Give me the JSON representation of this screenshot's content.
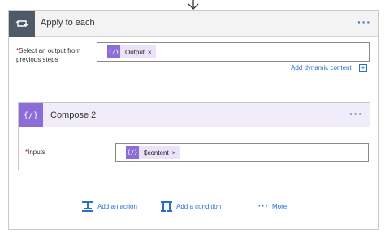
{
  "loop": {
    "title": "Apply to each",
    "more": "···",
    "select_label": "Select an output from previous steps",
    "required_mark": "*",
    "token": {
      "icon": "{/}",
      "label": "Output",
      "close": "×"
    },
    "dynamic_link": "Add dynamic content",
    "dynamic_icon": "+"
  },
  "compose": {
    "title": "Compose 2",
    "icon": "{/}",
    "more": "···",
    "inputs_label": "Inputs",
    "required_mark": "*",
    "token": {
      "icon": "{/}",
      "label": "$content",
      "close": "×"
    }
  },
  "actions": {
    "add_action": "Add an action",
    "add_condition": "Add a condition",
    "more_dots": "···",
    "more": "More"
  },
  "colors": {
    "accent_blue": "#2a6fc9",
    "loop_icon_bg": "#4f5a68",
    "compose_purple": "#8c6cd9",
    "required_red": "#c4262e"
  },
  "icons": {
    "top": "down-arrow-icon",
    "loop": "loop-icon",
    "compose": "compose-icon",
    "action": "add-action-icon",
    "condition": "add-condition-icon"
  }
}
